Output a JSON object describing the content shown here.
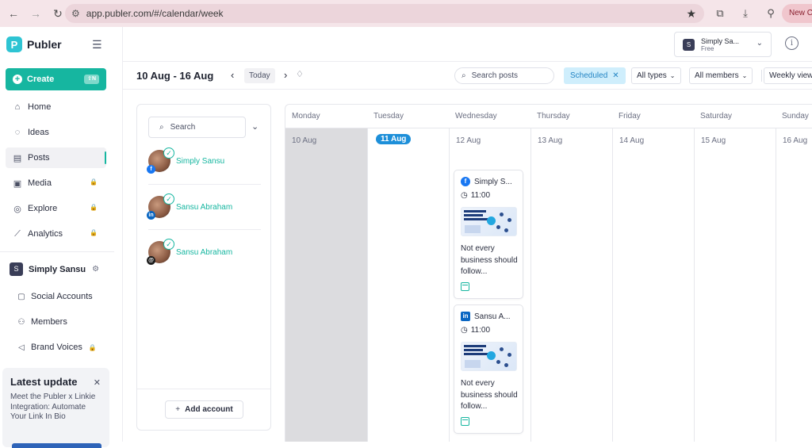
{
  "browser": {
    "url": "app.publer.com/#/calendar/week",
    "new_chrome_label": "New Ch"
  },
  "sidebar": {
    "brand": "Publer",
    "create_label": "Create",
    "create_shortcut": "⇧N",
    "nav": [
      {
        "label": "Home",
        "icon": "home-icon",
        "locked": false
      },
      {
        "label": "Ideas",
        "icon": "lightbulb-icon",
        "locked": false
      },
      {
        "label": "Posts",
        "icon": "calendar-icon",
        "locked": false,
        "active": true
      },
      {
        "label": "Media",
        "icon": "image-icon",
        "locked": true
      },
      {
        "label": "Explore",
        "icon": "compass-icon",
        "locked": true
      },
      {
        "label": "Analytics",
        "icon": "chart-icon",
        "locked": true
      }
    ],
    "workspace": {
      "initial": "S",
      "name": "Simply Sansu"
    },
    "workspace_items": [
      {
        "label": "Social Accounts",
        "icon": "accounts-icon",
        "locked": false
      },
      {
        "label": "Members",
        "icon": "members-icon",
        "locked": false
      },
      {
        "label": "Brand Voices",
        "icon": "megaphone-icon",
        "locked": true
      }
    ],
    "update": {
      "title": "Latest update",
      "text": "Meet the Publer x Linkie Integration: Automate Your Link In Bio"
    }
  },
  "topbar": {
    "workspace_name": "Simply Sa...",
    "workspace_plan": "Free",
    "workspace_initial": "S"
  },
  "toolbar": {
    "date_range": "10 Aug - 16 Aug",
    "today_label": "Today",
    "search_placeholder": "Search posts",
    "status_chip": "Scheduled",
    "types_label": "All types",
    "members_label": "All members",
    "view_label": "Weekly view"
  },
  "accounts": {
    "search_label": "Search",
    "items": [
      {
        "name": "Simply Sansu",
        "network": "facebook",
        "network_glyph": "f"
      },
      {
        "name": "Sansu Abraham",
        "network": "linkedin",
        "network_glyph": "in"
      },
      {
        "name": "Sansu Abraham",
        "network": "threads",
        "network_glyph": "@"
      }
    ],
    "add_label": "Add account"
  },
  "calendar": {
    "days": [
      {
        "name": "Monday",
        "date": "10 Aug",
        "past": true
      },
      {
        "name": "Tuesday",
        "date": "11 Aug",
        "today": true
      },
      {
        "name": "Wednesday",
        "date": "12 Aug"
      },
      {
        "name": "Thursday",
        "date": "13 Aug"
      },
      {
        "name": "Friday",
        "date": "14 Aug"
      },
      {
        "name": "Saturday",
        "date": "15 Aug"
      },
      {
        "name": "Sunday",
        "date": "16 Aug"
      }
    ],
    "posts": [
      {
        "account": "Simply S...",
        "network": "facebook",
        "network_glyph": "f",
        "time": "11:00",
        "text": "Not every business should follow..."
      },
      {
        "account": "Sansu A...",
        "network": "linkedin",
        "network_glyph": "in",
        "time": "11:00",
        "text": "Not every business should follow..."
      }
    ]
  },
  "colors": {
    "accent": "#16b6a0",
    "today_badge": "#1d8fd9",
    "scheduled_chip_bg": "#cfeefc",
    "facebook": "#1877f2",
    "linkedin": "#0a66c2"
  }
}
